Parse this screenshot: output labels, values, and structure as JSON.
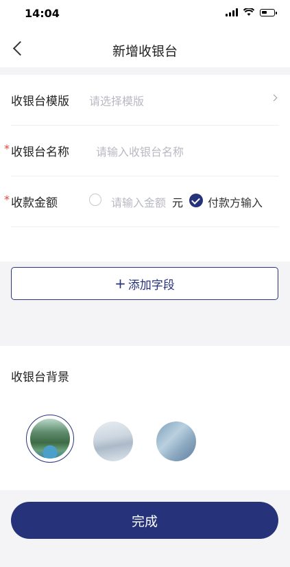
{
  "status_bar": {
    "time": "14:04",
    "battery_level": 0.45
  },
  "nav": {
    "title": "新增收银台"
  },
  "form": {
    "template": {
      "label": "收银台模版",
      "placeholder": "请选择模版"
    },
    "name": {
      "required_mark": "*",
      "label": "收银台名称",
      "placeholder": "请输入收银台名称"
    },
    "amount": {
      "required_mark": "*",
      "label": "收款金额",
      "placeholder": "请输入金额",
      "unit": "元",
      "option_label": "付款方输入",
      "option_checked": true
    }
  },
  "add_field": {
    "plus": "+",
    "label": "添加字段"
  },
  "background": {
    "title": "收银台背景",
    "selected_index": 0
  },
  "footer": {
    "done_label": "完成"
  },
  "colors": {
    "primary": "#26337a",
    "required": "#e0453a",
    "placeholder": "#b8b9c3"
  }
}
